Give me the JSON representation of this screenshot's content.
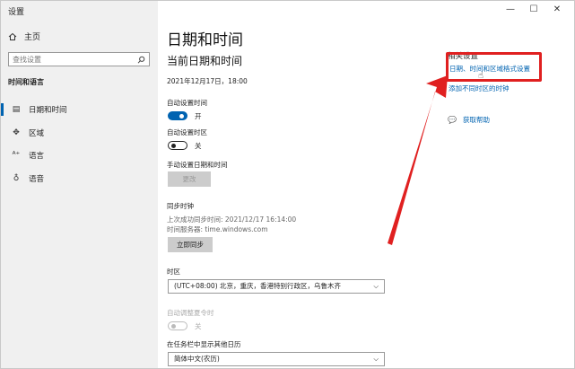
{
  "window": {
    "title": "设置",
    "minimize": "—",
    "maximize": "☐",
    "close": "✕"
  },
  "sidebar": {
    "home": "主页",
    "search_placeholder": "查找设置",
    "section": "时间和语言",
    "items": [
      {
        "label": "日期和时间",
        "icon": "calendar-icon",
        "active": true
      },
      {
        "label": "区域",
        "icon": "region-icon",
        "active": false
      },
      {
        "label": "语言",
        "icon": "language-icon",
        "active": false
      },
      {
        "label": "语音",
        "icon": "microphone-icon",
        "active": false
      }
    ]
  },
  "main": {
    "title": "日期和时间",
    "current_heading": "当前日期和时间",
    "current_datetime": "2021年12月17日，18:00",
    "auto_time": {
      "label": "自动设置时间",
      "state": "开"
    },
    "auto_zone": {
      "label": "自动设置时区",
      "state": "关"
    },
    "manual": {
      "label": "手动设置日期和时间",
      "button": "更改"
    },
    "sync": {
      "heading": "同步时钟",
      "last": "上次成功同步时间: 2021/12/17 16:14:00",
      "server": "时间服务器: time.windows.com",
      "button": "立即同步"
    },
    "timezone": {
      "label": "时区",
      "value": "(UTC+08:00) 北京，重庆，香港特别行政区，乌鲁木齐"
    },
    "dst": {
      "label": "自动调整夏令时",
      "state": "关"
    },
    "taskbar": {
      "label": "在任务栏中显示其他日历",
      "value": "简体中文(农历)"
    }
  },
  "related": {
    "heading": "相关设置",
    "link1": "日期、时间和区域格式设置",
    "link2": "添加不同时区的时钟",
    "help": "获取帮助"
  },
  "colors": {
    "accent": "#0063b1",
    "callout": "#e02020"
  }
}
